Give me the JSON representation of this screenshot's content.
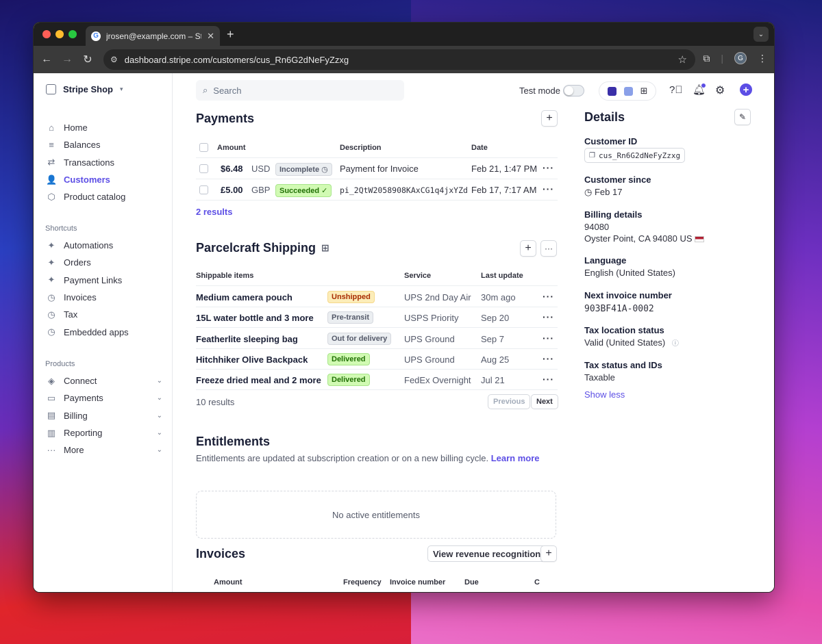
{
  "browser": {
    "tab_title": "jrosen@example.com – Stripe",
    "url": "dashboard.stripe.com/customers/cus_Rn6G2dNeFyZzxg",
    "profile_initial": "G"
  },
  "sidebar": {
    "brand": "Stripe Shop",
    "main_items": [
      {
        "label": "Home"
      },
      {
        "label": "Balances"
      },
      {
        "label": "Transactions"
      },
      {
        "label": "Customers"
      },
      {
        "label": "Product catalog"
      }
    ],
    "shortcuts_heading": "Shortcuts",
    "shortcuts": [
      {
        "label": "Automations"
      },
      {
        "label": "Orders"
      },
      {
        "label": "Payment Links"
      },
      {
        "label": "Invoices"
      },
      {
        "label": "Tax"
      },
      {
        "label": "Embedded apps"
      }
    ],
    "products_heading": "Products",
    "products": [
      {
        "label": "Connect"
      },
      {
        "label": "Payments"
      },
      {
        "label": "Billing"
      },
      {
        "label": "Reporting"
      },
      {
        "label": "More"
      }
    ]
  },
  "topbar": {
    "search_placeholder": "Search",
    "test_mode_label": "Test mode"
  },
  "payments": {
    "title": "Payments",
    "columns": [
      "Amount",
      "Description",
      "Date"
    ],
    "rows": [
      {
        "amount": "$6.48",
        "currency": "USD",
        "status": "Incomplete",
        "description": "Payment for Invoice",
        "date": "Feb 21, 1:47 PM"
      },
      {
        "amount": "£5.00",
        "currency": "GBP",
        "status": "Succeeded",
        "description": "pi_2QtW2058908KAxCG1q4jxYZd",
        "date": "Feb 17, 7:17 AM"
      }
    ],
    "results": "2 results"
  },
  "shipping": {
    "title": "Parcelcraft Shipping",
    "columns": [
      "Shippable items",
      "Service",
      "Last update"
    ],
    "rows": [
      {
        "item": "Medium camera pouch",
        "status": "Unshipped",
        "service": "UPS 2nd Day Air",
        "updated": "30m ago"
      },
      {
        "item": "15L water bottle and 3 more",
        "status": "Pre-transit",
        "service": "USPS Priority",
        "updated": "Sep 20"
      },
      {
        "item": "Featherlite sleeping bag",
        "status": "Out for delivery",
        "service": "UPS Ground",
        "updated": "Sep 7"
      },
      {
        "item": "Hitchhiker Olive Backpack",
        "status": "Delivered",
        "service": "UPS Ground",
        "updated": "Aug 25"
      },
      {
        "item": "Freeze dried meal and 2 more",
        "status": "Delivered",
        "service": "FedEx Overnight",
        "updated": "Jul 21"
      }
    ],
    "results": "10 results",
    "previous": "Previous",
    "next": "Next"
  },
  "entitlements": {
    "title": "Entitlements",
    "description": "Entitlements are updated at subscription creation or on a new billing cycle.",
    "learn_more": "Learn more",
    "empty": "No active entitlements"
  },
  "invoices": {
    "title": "Invoices",
    "revenue_button": "View revenue recognition",
    "columns": [
      "Amount",
      "Frequency",
      "Invoice number",
      "Due",
      "C"
    ]
  },
  "details": {
    "title": "Details",
    "customer_id_label": "Customer ID",
    "customer_id": "cus_Rn6G2dNeFyZzxg",
    "since_label": "Customer since",
    "since": "Feb 17",
    "billing_label": "Billing details",
    "billing_line1": "94080",
    "billing_line2": "Oyster Point, CA 94080 US",
    "language_label": "Language",
    "language": "English (United States)",
    "invoice_num_label": "Next invoice number",
    "invoice_num": "903BF41A-0002",
    "tax_loc_label": "Tax location status",
    "tax_loc": "Valid (United States)",
    "tax_status_label": "Tax status and IDs",
    "tax_status": "Taxable",
    "show_less": "Show less"
  }
}
